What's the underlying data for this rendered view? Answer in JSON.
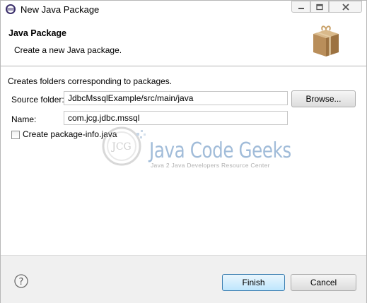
{
  "window": {
    "title": "New Java Package",
    "icon": "eclipse-icon"
  },
  "banner": {
    "title": "Java Package",
    "description": "Create a new Java package.",
    "icon": "package-icon"
  },
  "form": {
    "hint": "Creates folders corresponding to packages.",
    "source_folder_label": "Source folder:",
    "source_folder_value": "JdbcMssqlExample/src/main/java",
    "browse_label": "Browse...",
    "name_label": "Name:",
    "name_value": "com.jcg.jdbc.mssql",
    "create_package_info_label": "Create package-info.java",
    "create_package_info_checked": false
  },
  "watermark": {
    "logo_text": "JCG",
    "title": "Java Code Geeks",
    "subtitle": "Java 2 Java Developers Resource Center"
  },
  "footer": {
    "help_icon": "help-icon",
    "finish_label": "Finish",
    "cancel_label": "Cancel"
  },
  "colors": {
    "finish_border": "#3c7fb1",
    "watermark_blue": "#7aa1c9"
  }
}
